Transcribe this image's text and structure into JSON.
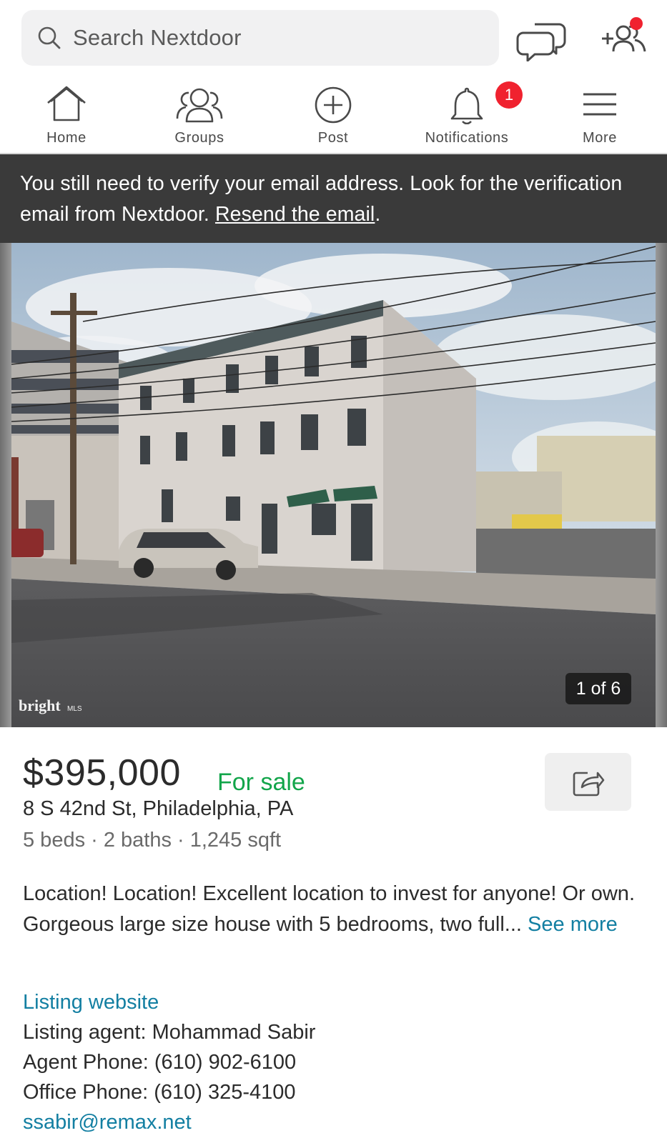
{
  "search": {
    "placeholder": "Search Nextdoor"
  },
  "nav": {
    "items": [
      {
        "label": "Home",
        "icon": "home-icon"
      },
      {
        "label": "Groups",
        "icon": "groups-icon"
      },
      {
        "label": "Post",
        "icon": "plus-circle-icon"
      },
      {
        "label": "Notifications",
        "icon": "bell-icon"
      },
      {
        "label": "More",
        "icon": "hamburger-icon"
      }
    ],
    "notification_count": "1"
  },
  "banner": {
    "message": "You still need to verify your email address. Look for the verification email from Nextdoor.",
    "link_label": "Resend the email",
    "trailing": "."
  },
  "photo": {
    "counter": "1 of 6",
    "watermark": "bright MLS"
  },
  "listing": {
    "price": "$395,000",
    "status": "For sale",
    "address": "8 S 42nd St, Philadelphia, PA",
    "specs": "5 beds · 2 baths · 1,245 sqft",
    "description": "Location! Location! Excellent location to invest for anyone! Or own. Gorgeous large size house with 5 bedrooms, two full...",
    "see_more": "See more",
    "listing_website": "Listing website",
    "agent": "Listing agent: Mohammad Sabir",
    "agent_phone": "Agent Phone: (610) 902-6100",
    "office_phone": "Office Phone: (610) 325-4100",
    "email": "ssabir@remax.net"
  },
  "colors": {
    "accent_green": "#12a54a",
    "link_blue": "#137fa2",
    "badge_red": "#f0222f",
    "banner_bg": "#3a3a3a"
  }
}
